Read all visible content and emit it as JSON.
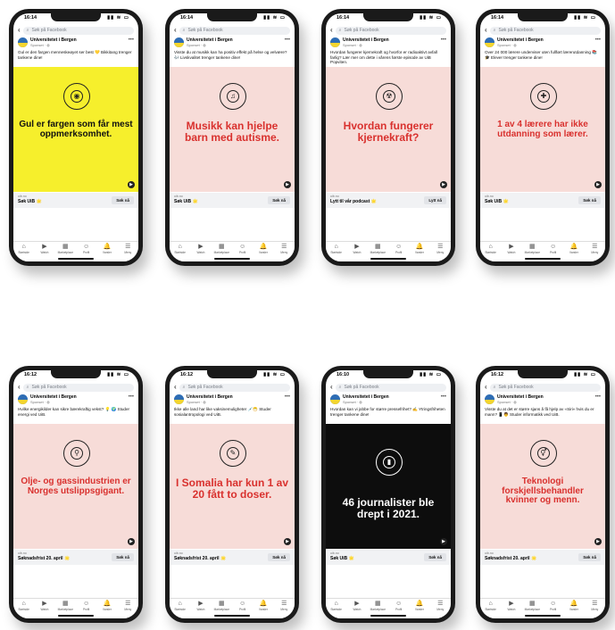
{
  "search_placeholder": "Søk på Facebook",
  "author": "Universitetet i Bergen",
  "sponsored": "Sponset · ",
  "tabs": [
    "Startside",
    "Watch",
    "Marketplace",
    "Profil",
    "Varsler",
    "Meny"
  ],
  "phones": [
    {
      "time": "16:14",
      "caption": "Gul er den fargen menneskeøyet ser best 💛 Bikkitang trenger tankene dine!",
      "headline": "Gul er fargen som får mest oppmerksomhet.",
      "bg": "#f6ef2c",
      "fg": "#111111",
      "icon": "eye-icon",
      "cta_domain": "uib.no",
      "cta_title": "Søk UiB 🌟",
      "cta_button": "Søk nå"
    },
    {
      "time": "16:14",
      "caption": "Visste du at musikk kan ha positiv effekt på helse og velvære? 🎶 Livskvalitet trenger tankene dine!",
      "headline": "Musikk kan hjelpe barn med autisme.",
      "bg": "#f7dcd8",
      "fg": "#d9312e",
      "icon": "music-note-icon",
      "cta_domain": "uib.no",
      "cta_title": "Søk UiB 🌟",
      "cta_button": "Søk nå"
    },
    {
      "time": "16:14",
      "caption": "Hvordan fungerer kjernekraft og hvorfor er radioaktivt avfall farlig? Lær mer om dette i vårens første episode av UiB Popviten.",
      "headline": "Hvordan fungerer kjernekraft?",
      "bg": "#f7dcd8",
      "fg": "#d9312e",
      "icon": "radioactive-icon",
      "cta_domain": "uib.no",
      "cta_title": "Lytt til vår podcast 🌟",
      "cta_button": "Lytt nå"
    },
    {
      "time": "16:14",
      "caption": "Over 24 000 lærere underviser uten fullført lærerutdanning 📚🎓 Elever trenger tankene dine!",
      "headline": "1 av 4 lærere har ikke utdanning som lærer.",
      "bg": "#f7dcd8",
      "fg": "#d9312e",
      "icon": "graduation-icon",
      "cta_domain": "uib.no",
      "cta_title": "Søk UiB 🌟",
      "cta_button": "Søk nå"
    },
    {
      "time": "16:12",
      "caption": "Hvilke energikilder kan sikre bærekraftig vekst? 💡 🌍 Studer energi ved UiB.",
      "headline": "Olje- og gassindustrien er Norges utslippsgigant.",
      "bg": "#f7dcd8",
      "fg": "#d9312e",
      "icon": "oil-drop-icon",
      "cta_domain": "uib.no",
      "cta_title": "Søknadsfrist 20. april 🌟",
      "cta_button": "Søk nå"
    },
    {
      "time": "16:12",
      "caption": "Ikke alle land har like vaksinemuligheter 💉😷 Studer sosialantropologi ved UiB.",
      "headline": "I Somalia har kun 1 av 20 fått to doser.",
      "bg": "#f7dcd8",
      "fg": "#d9312e",
      "icon": "syringe-icon",
      "cta_domain": "uib.no",
      "cta_title": "Søknadsfrist 20. april 🌟",
      "cta_button": "Søk nå"
    },
    {
      "time": "16:10",
      "caption": "Hvordan kan vi jobbe for større pressefrihet? ✍️ Ytringsfriheten trenger tankene dine!",
      "headline": "46 journalister ble drept i 2021.",
      "bg": "#0d0d0d",
      "fg": "#ffffff",
      "icon": "candle-icon",
      "cta_domain": "uib.no",
      "cta_title": "Søk UiB 🌟",
      "cta_button": "Søk nå"
    },
    {
      "time": "16:12",
      "caption": "Visste du at det er større sjans å få hjelp av «Siri» hvis du er mann? 📱👨 Studer informatikk ved UiB.",
      "headline": "Teknologi forskjellsbehandler kvinner og menn.",
      "bg": "#f7dcd8",
      "fg": "#d9312e",
      "icon": "gender-icon",
      "cta_domain": "uib.no",
      "cta_title": "Søknadsfrist 20. april 🌟",
      "cta_button": "Søk nå"
    }
  ]
}
